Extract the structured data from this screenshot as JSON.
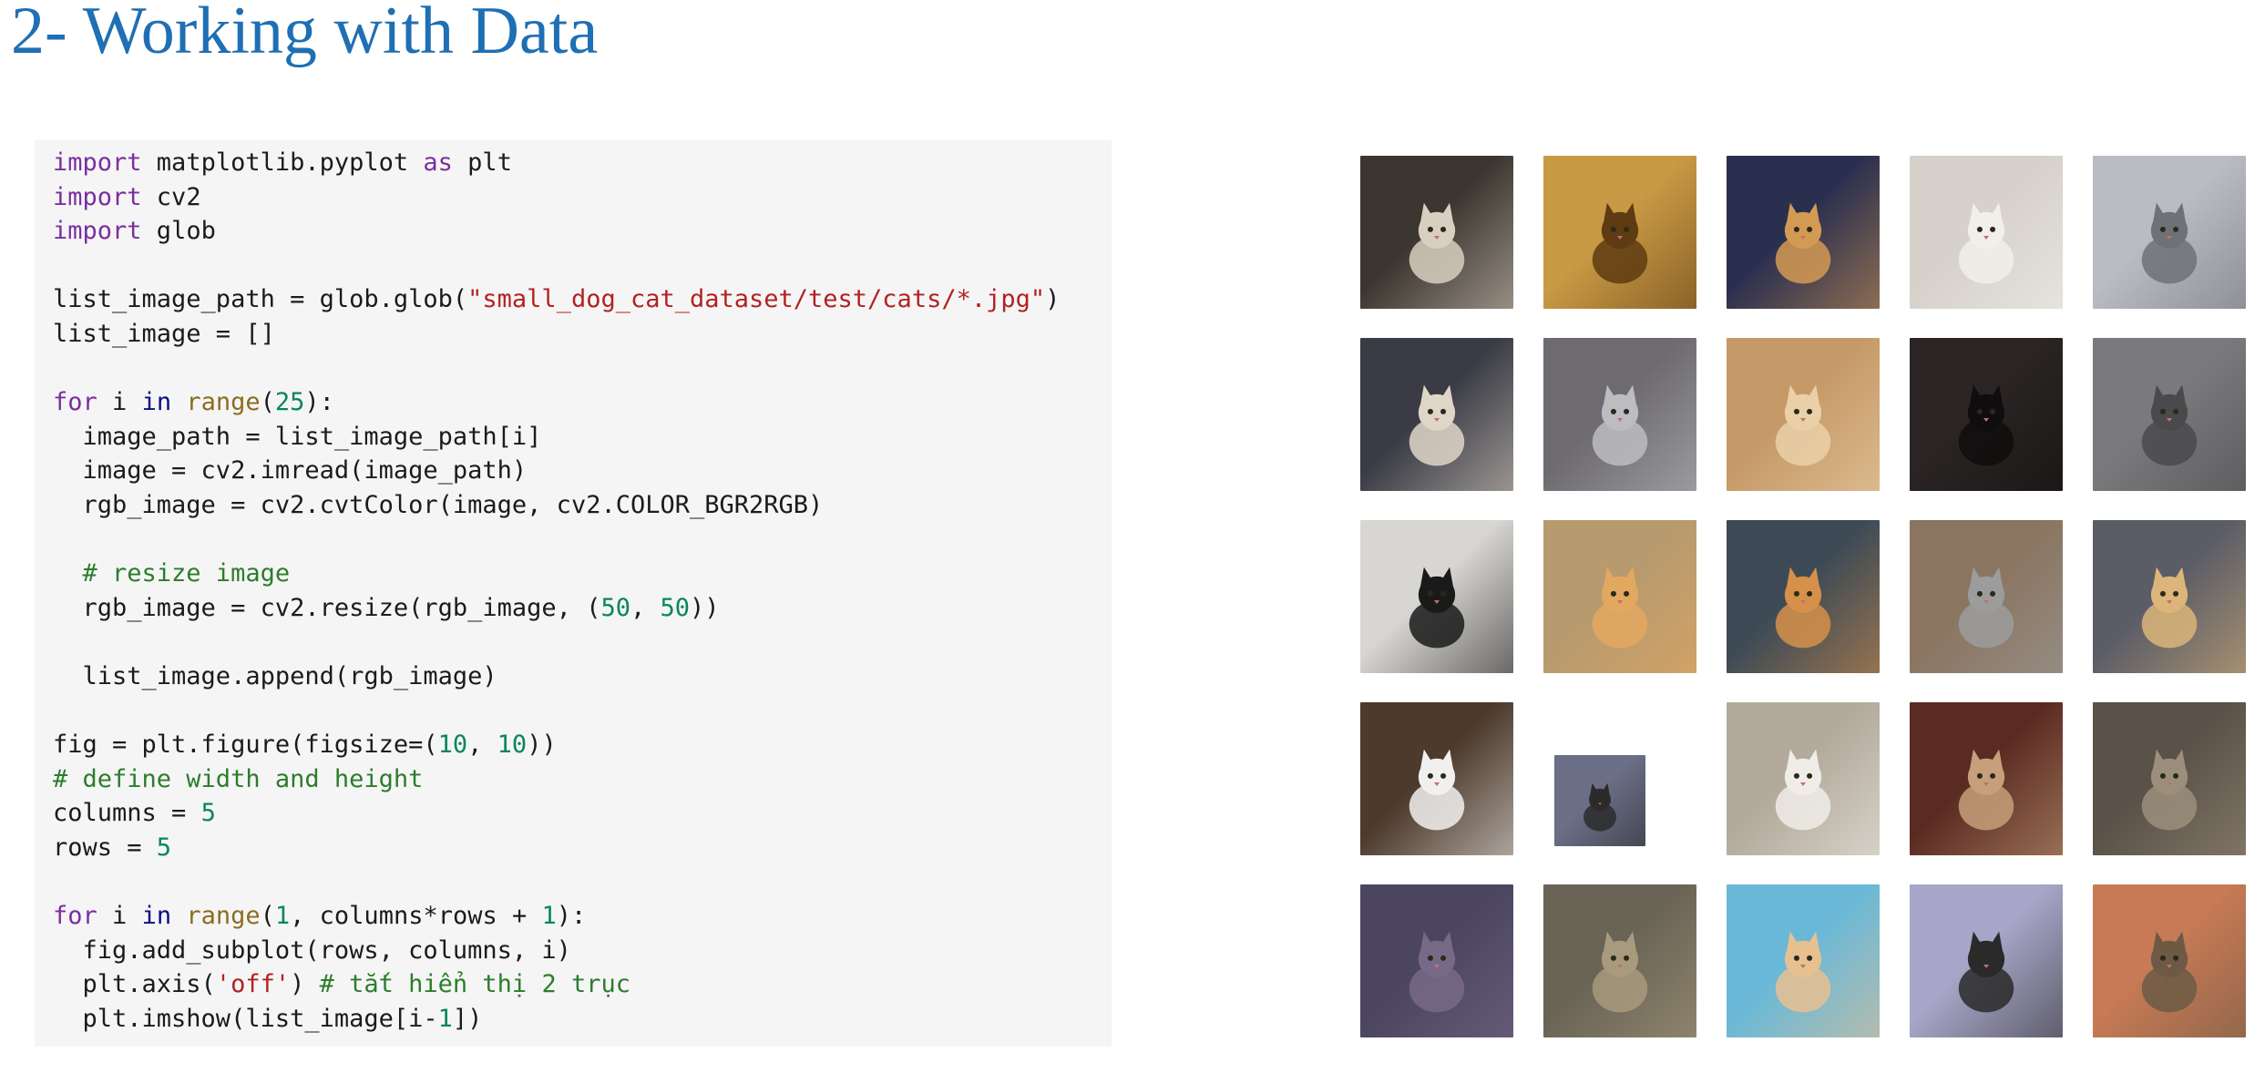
{
  "page": {
    "title": "2- Working with Data"
  },
  "code": {
    "lines": [
      [
        {
          "t": "import",
          "c": "kw"
        },
        {
          "t": " matplotlib.pyplot ",
          "c": ""
        },
        {
          "t": "as",
          "c": "kw"
        },
        {
          "t": " plt",
          "c": ""
        }
      ],
      [
        {
          "t": "import",
          "c": "kw"
        },
        {
          "t": " cv2",
          "c": ""
        }
      ],
      [
        {
          "t": "import",
          "c": "kw"
        },
        {
          "t": " glob",
          "c": ""
        }
      ],
      [],
      [
        {
          "t": "list_image_path = glob.glob(",
          "c": ""
        },
        {
          "t": "\"small_dog_cat_dataset/test/cats/*.jpg\"",
          "c": "str"
        },
        {
          "t": ")",
          "c": ""
        }
      ],
      [
        {
          "t": "list_image = []",
          "c": ""
        }
      ],
      [],
      [
        {
          "t": "for",
          "c": "kw"
        },
        {
          "t": " i ",
          "c": ""
        },
        {
          "t": "in",
          "c": "kwb"
        },
        {
          "t": " ",
          "c": ""
        },
        {
          "t": "range",
          "c": "bi"
        },
        {
          "t": "(",
          "c": ""
        },
        {
          "t": "25",
          "c": "num"
        },
        {
          "t": "):",
          "c": ""
        }
      ],
      [
        {
          "t": "  image_path = list_image_path[i]",
          "c": ""
        }
      ],
      [
        {
          "t": "  image = cv2.imread(image_path)",
          "c": ""
        }
      ],
      [
        {
          "t": "  rgb_image = cv2.cvtColor(image, cv2.COLOR_BGR2RGB)",
          "c": ""
        }
      ],
      [],
      [
        {
          "t": "  # resize image",
          "c": "cmt"
        }
      ],
      [
        {
          "t": "  rgb_image = cv2.resize(rgb_image, (",
          "c": ""
        },
        {
          "t": "50",
          "c": "num"
        },
        {
          "t": ", ",
          "c": ""
        },
        {
          "t": "50",
          "c": "num"
        },
        {
          "t": "))",
          "c": ""
        }
      ],
      [],
      [
        {
          "t": "  list_image.append(rgb_image)",
          "c": ""
        }
      ],
      [],
      [
        {
          "t": "fig = plt.figure(figsize=(",
          "c": ""
        },
        {
          "t": "10",
          "c": "num"
        },
        {
          "t": ", ",
          "c": ""
        },
        {
          "t": "10",
          "c": "num"
        },
        {
          "t": "))",
          "c": ""
        }
      ],
      [
        {
          "t": "# define width and height",
          "c": "cmt"
        }
      ],
      [
        {
          "t": "columns = ",
          "c": ""
        },
        {
          "t": "5",
          "c": "num"
        }
      ],
      [
        {
          "t": "rows = ",
          "c": ""
        },
        {
          "t": "5",
          "c": "num"
        }
      ],
      [],
      [
        {
          "t": "for",
          "c": "kw"
        },
        {
          "t": " i ",
          "c": ""
        },
        {
          "t": "in",
          "c": "kwb"
        },
        {
          "t": " ",
          "c": ""
        },
        {
          "t": "range",
          "c": "bi"
        },
        {
          "t": "(",
          "c": ""
        },
        {
          "t": "1",
          "c": "num"
        },
        {
          "t": ", columns*rows + ",
          "c": ""
        },
        {
          "t": "1",
          "c": "num"
        },
        {
          "t": "):",
          "c": ""
        }
      ],
      [
        {
          "t": "  fig.add_subplot(rows, columns, i)",
          "c": ""
        }
      ],
      [
        {
          "t": "  plt.axis(",
          "c": ""
        },
        {
          "t": "'off'",
          "c": "str"
        },
        {
          "t": ") ",
          "c": ""
        },
        {
          "t": "# tắt hiển thị 2 trục",
          "c": "cmt"
        }
      ],
      [
        {
          "t": "  plt.imshow(list_image[i-",
          "c": ""
        },
        {
          "t": "1",
          "c": "num"
        },
        {
          "t": "])",
          "c": ""
        }
      ]
    ]
  },
  "output": {
    "columns": 5,
    "rows": 5,
    "images": [
      {
        "label": "cat",
        "bg": "#3c3630",
        "fg": "#d9cfc0",
        "small": false
      },
      {
        "label": "cat",
        "bg": "#c99a45",
        "fg": "#5e3b12",
        "small": false
      },
      {
        "label": "cat",
        "bg": "#2b2f4f",
        "fg": "#d39a54",
        "small": false
      },
      {
        "label": "cat",
        "bg": "#d6d1cb",
        "fg": "#f2efeb",
        "small": false
      },
      {
        "label": "cat",
        "bg": "#b9bcc2",
        "fg": "#6e7176",
        "small": false
      },
      {
        "label": "cat",
        "bg": "#3a3b45",
        "fg": "#e0d6c8",
        "small": false
      },
      {
        "label": "cat",
        "bg": "#6d6b70",
        "fg": "#bdbcc0",
        "small": false
      },
      {
        "label": "cat",
        "bg": "#c69a68",
        "fg": "#ead0a8",
        "small": false
      },
      {
        "label": "cat",
        "bg": "#2a2524",
        "fg": "#0f0d0d",
        "small": false
      },
      {
        "label": "cat",
        "bg": "#7a7a7c",
        "fg": "#4a4a4c",
        "small": false
      },
      {
        "label": "cat",
        "bg": "#d8d6d2",
        "fg": "#1a1a1a",
        "small": false
      },
      {
        "label": "cat",
        "bg": "#b79a6e",
        "fg": "#e3a860",
        "small": false
      },
      {
        "label": "cat",
        "bg": "#3d4a56",
        "fg": "#d6904a",
        "small": false
      },
      {
        "label": "cat",
        "bg": "#8a7560",
        "fg": "#9c9c9c",
        "small": false
      },
      {
        "label": "cat",
        "bg": "#5a5c66",
        "fg": "#dcb57a",
        "small": false
      },
      {
        "label": "cat",
        "bg": "#4c3a2c",
        "fg": "#f2f0ee",
        "small": false
      },
      {
        "label": "cat",
        "bg": "#6a6e86",
        "fg": "#2b2b2b",
        "small": true
      },
      {
        "label": "cat",
        "bg": "#b3aa9c",
        "fg": "#f0ede8",
        "small": false
      },
      {
        "label": "cat",
        "bg": "#5a2b22",
        "fg": "#c6a07a",
        "small": false
      },
      {
        "label": "cat",
        "bg": "#5a5148",
        "fg": "#9b8f7c",
        "small": false
      },
      {
        "label": "cat",
        "bg": "#4b4560",
        "fg": "#776a88",
        "small": false
      },
      {
        "label": "cat",
        "bg": "#6a6456",
        "fg": "#a89a7c",
        "small": false
      },
      {
        "label": "cat",
        "bg": "#69b8d8",
        "fg": "#e7c090",
        "small": false
      },
      {
        "label": "cat",
        "bg": "#a8a6c8",
        "fg": "#2a2a2a",
        "small": false
      },
      {
        "label": "cat",
        "bg": "#c77a55",
        "fg": "#6c5a45",
        "small": false
      }
    ]
  }
}
